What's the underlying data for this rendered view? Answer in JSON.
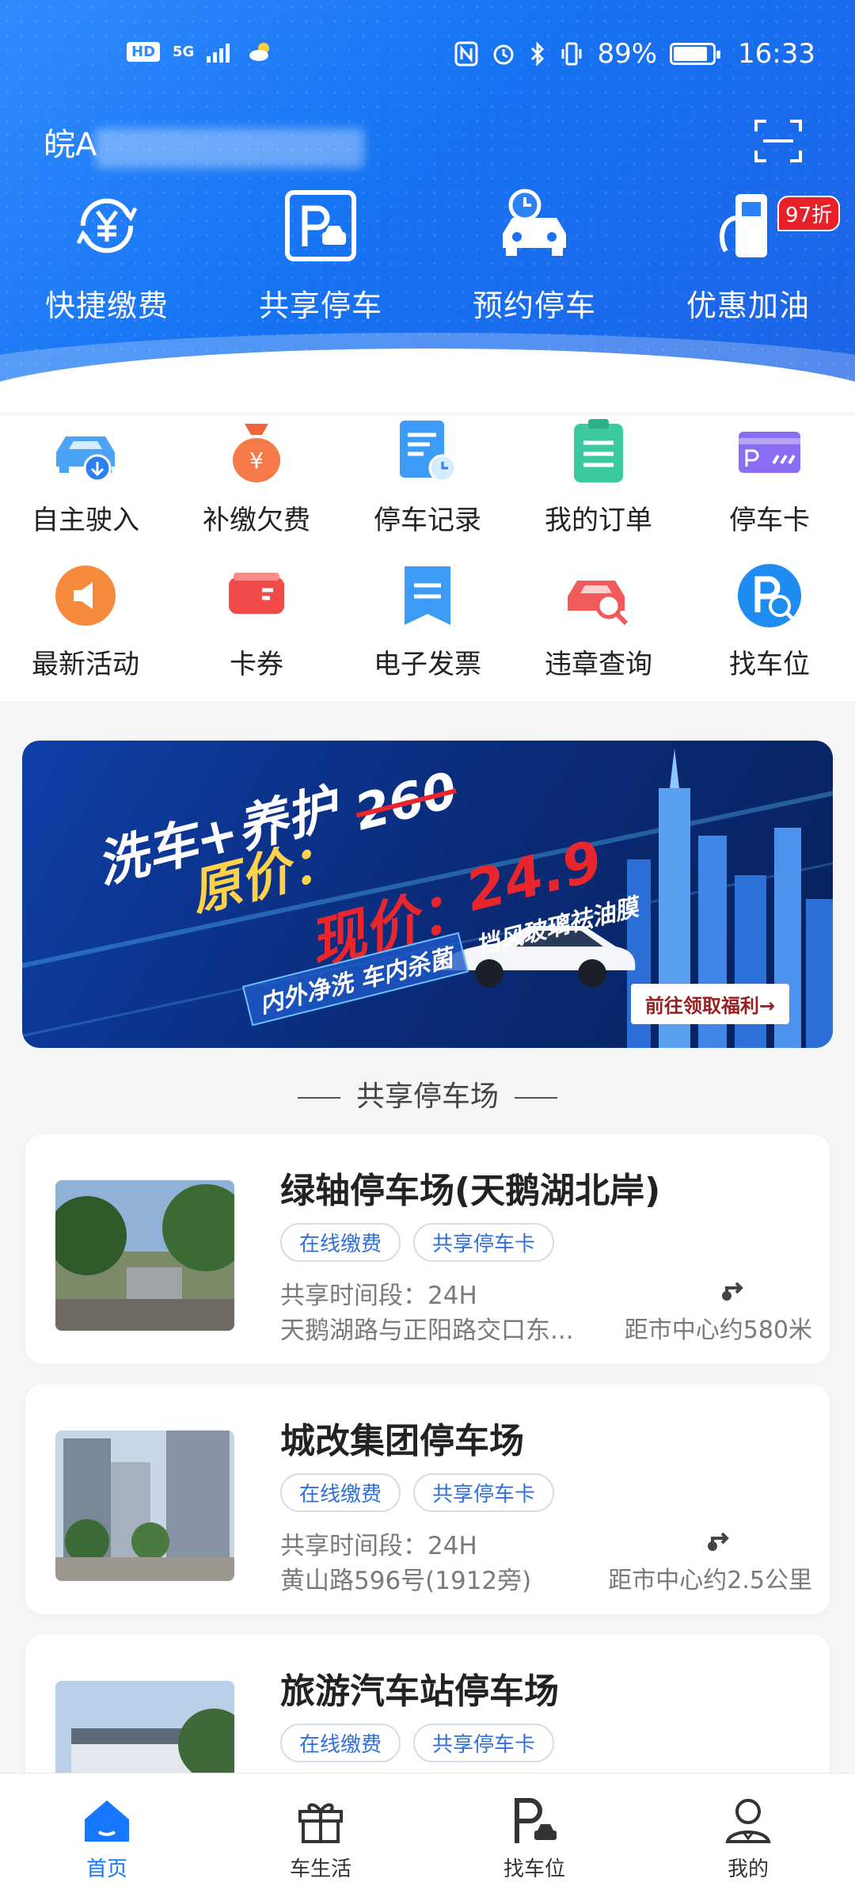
{
  "status_bar": {
    "left_badge": "HD",
    "network": "5G",
    "battery_text": "89%",
    "battery_level": 0.89,
    "time": "16:33"
  },
  "header": {
    "plate_prefix": "皖A",
    "scan_icon": "scan-icon",
    "quick_actions": [
      {
        "label": "快捷缴费",
        "icon": "yuan-refresh-icon"
      },
      {
        "label": "共享停车",
        "icon": "parking-car-icon"
      },
      {
        "label": "预约停车",
        "icon": "car-clock-icon"
      },
      {
        "label": "优惠加油",
        "icon": "fuel-pump-icon",
        "badge": "97折"
      }
    ]
  },
  "services": [
    {
      "label": "自主驶入",
      "icon": "car-enter-icon"
    },
    {
      "label": "补缴欠费",
      "icon": "money-bag-icon"
    },
    {
      "label": "停车记录",
      "icon": "record-clock-icon"
    },
    {
      "label": "我的订单",
      "icon": "clipboard-icon"
    },
    {
      "label": "停车卡",
      "icon": "parking-card-icon"
    },
    {
      "label": "最新活动",
      "icon": "speaker-icon"
    },
    {
      "label": "卡券",
      "icon": "coupon-icon"
    },
    {
      "label": "电子发票",
      "icon": "invoice-icon"
    },
    {
      "label": "违章查询",
      "icon": "car-search-icon"
    },
    {
      "label": "找车位",
      "icon": "parking-search-icon"
    }
  ],
  "banner": {
    "line1": "洗车+养护",
    "original_label": "原价：",
    "original_price": "260",
    "current_label": "现价：",
    "current_price": "24.9",
    "tag_windshield": "挡风玻璃祛油膜",
    "tag_services": "内外净洗  车内杀菌",
    "button": "前往领取福利→"
  },
  "section_title": "共享停车场",
  "parking_lots": [
    {
      "name": "绿轴停车场(天鹅湖北岸)",
      "tags": [
        "在线缴费",
        "共享停车卡"
      ],
      "hours": "共享时间段：24H",
      "address": "天鹅湖路与正阳路交口东...",
      "distance": "距市中心约580米"
    },
    {
      "name": "城改集团停车场",
      "tags": [
        "在线缴费",
        "共享停车卡"
      ],
      "hours": "共享时间段：24H",
      "address": "黄山路596号(1912旁)",
      "distance": "距市中心约2.5公里"
    },
    {
      "name": "旅游汽车站停车场",
      "tags": [
        "在线缴费",
        "共享停车卡"
      ],
      "hours": "",
      "address": "",
      "distance": ""
    }
  ],
  "bottom_nav": [
    {
      "label": "首页",
      "icon": "home-icon",
      "active": true
    },
    {
      "label": "车生活",
      "icon": "gift-icon",
      "active": false
    },
    {
      "label": "找车位",
      "icon": "parking-icon",
      "active": false
    },
    {
      "label": "我的",
      "icon": "user-icon",
      "active": false
    }
  ],
  "colors": {
    "primary": "#1677ff",
    "header_gradient_start": "#2f8cff",
    "header_gradient_end": "#1e63e6",
    "discount_red": "#e8202a",
    "tag_blue": "#2f6fe0"
  }
}
